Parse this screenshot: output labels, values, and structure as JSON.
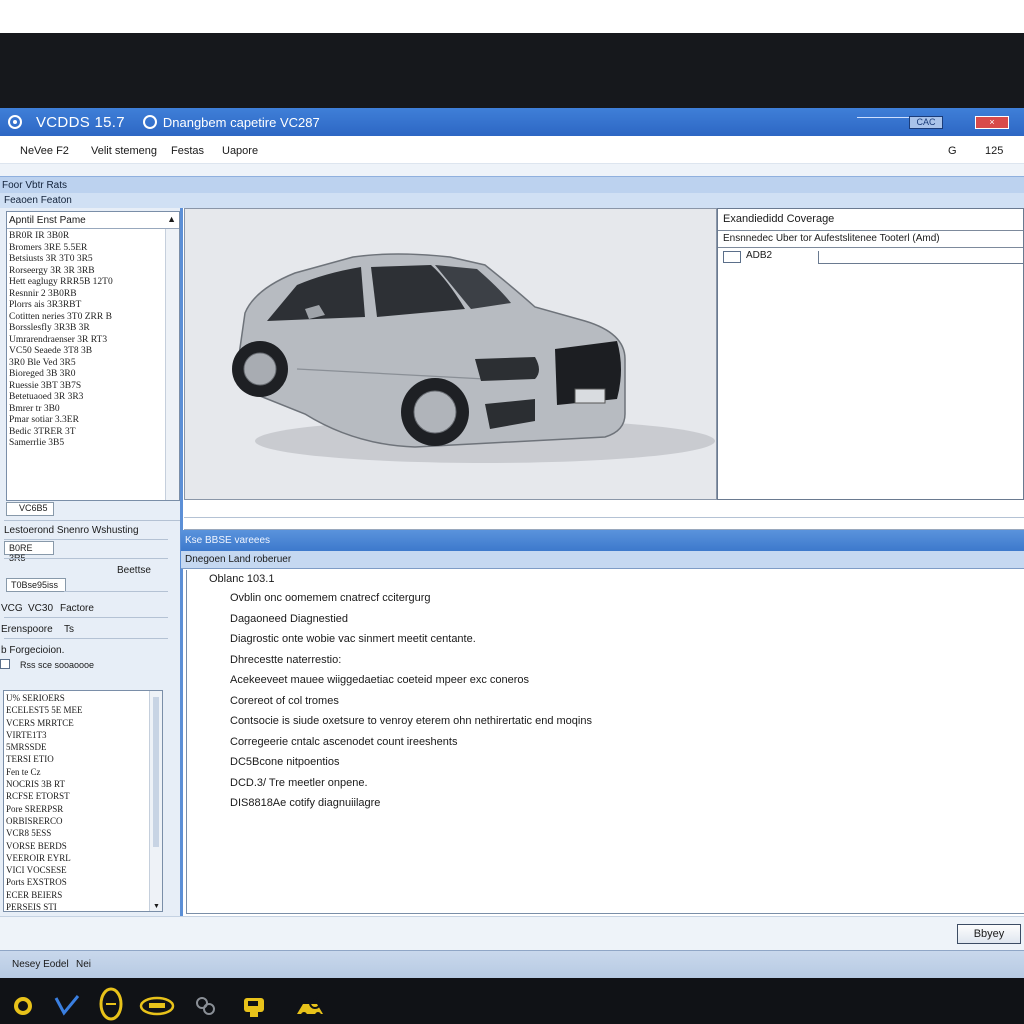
{
  "window": {
    "app_title": "VCDDS  15.7",
    "doc_title": "Dnangbem capetire VC287",
    "cac_label": "CAC",
    "close_label": "×"
  },
  "menu": {
    "items": [
      "NeVee F2",
      "Velit stemeng",
      "Festas",
      "Uapore"
    ],
    "right_1": "G",
    "right_2": "125"
  },
  "sections": {
    "bar1": "Foor Vbtr Rats",
    "bar2": "Feaoen Featon"
  },
  "param_panel": {
    "header": "Apntil Enst Pame",
    "items": [
      "BR0R IR 3B0R",
      "Bromers 3RE 5.5ER",
      "Betsiusts 3R 3T0 3R5",
      "Rorseergy 3R 3R 3RB",
      "Hett eaglugy RRR5B 12T0",
      "Resnnir 2 3B0RB",
      "Plorrs ais 3R3RBT",
      "Cotitten neries 3T0 ZRR B",
      "Borsslesfly 3R3B 3R",
      "Umrarendraenser 3R RT3",
      "VC50 Seaede 3T8 3B",
      "3R0 Ble Ved 3R5",
      "Bioreged 3B 3R0",
      "Ruessie 3BT 3B7S",
      "Betetuaoed 3R 3R3",
      "Bmrer tr 3B0",
      "Pmar sotiar 3.3ER",
      "Bedic 3TRER 3T",
      "Samerrlie 3B5"
    ]
  },
  "left_fields": {
    "vcds_field": "VC6B5",
    "label_1": "Lestoerond Snenro Wshusting",
    "field_2": "B0RE 3R5",
    "button_label": "Beettse",
    "field_3": "T0Bse95iss",
    "label_vcg": "VCG",
    "label_vc30": "VC30",
    "label_factore": "Factore",
    "label_erenspoore": "Erenspoore",
    "label_ts": "Ts",
    "label_forgecioion": "b Forgecioion.",
    "label_checkbox": "Rss sce sooaoooe"
  },
  "left_list": {
    "items": [
      "U% SERIOERS",
      "ECELEST5 5E MEE",
      "VCERS MRRTCE",
      "VIRTE1T3",
      "5MRSSDE",
      "TERSI ETIO",
      "Fen te Cz",
      "NOCRIS 3B RT",
      "RCFSE ETORST",
      "Pore SRERPSR",
      "ORBISRERCO",
      "VCR8 5ESS",
      "VORSE BERDS",
      "VEEROIR EYRL",
      "VICI VOCSESE",
      "Ports EXSTROS",
      "ECER BEIERS",
      "PERSEIS STI"
    ]
  },
  "coding": {
    "title": "Exandiedidd Coverage",
    "subtitle": "Ensnnedec Uber tor Aufestslitenee Tooterl (Amd)",
    "value": "ADB2"
  },
  "lower": {
    "bar1": "Kse BBSE vareees",
    "bar2": "Dnegoen Land roberuer"
  },
  "diagnostics": {
    "header": "Oblanc 103.1",
    "lines": [
      "Ovblin onc oomemem cnatrecf ccitergurg",
      "Dagaoneed Diagnestied",
      "Diagrostic onte wobie vac sinmert meetit centante.",
      "Dhrecestte naterrestio:",
      "Acekeeveet mauee wiiggedaetiac coeteid mpeer exc coneros",
      "Corereot of col tromes",
      "Contsocie is siude oxetsure to venroy eterem ohn nethirertatic end moqins",
      "Corregeerie cntalc ascenodet count ireeshents",
      "DC5Bcone nitpoentios",
      "DCD.3/ Tre meetler onpene.",
      "DIS8818Ae cotify diagnuiilagre"
    ]
  },
  "apply_label": "Bbyey",
  "status": {
    "left": "Nesey Eodel",
    "right": "Nei"
  },
  "colors": {
    "titlebar": "#2d67c4",
    "accent": "#3d79cc",
    "taskbar": "#101216"
  },
  "taskbar_icons": [
    "ring-icon",
    "check-v-icon",
    "key-oval-icon",
    "car-badge-icon",
    "gear-cluster-icon",
    "scanner-icon",
    "search-car-icon"
  ]
}
